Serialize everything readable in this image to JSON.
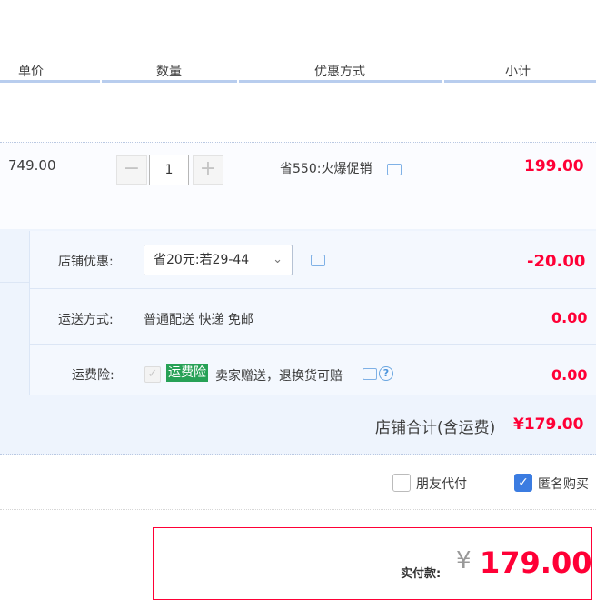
{
  "header": {
    "col_unit_price": "单价",
    "col_quantity": "数量",
    "col_promotion": "优惠方式",
    "col_subtotal": "小计"
  },
  "item": {
    "unit_price": "749.00",
    "quantity": "1",
    "stepper_minus": "−",
    "stepper_plus": "+",
    "promotion": "省550:火爆促销",
    "subtotal": "199.00"
  },
  "shop": {
    "discount_label": "店铺优惠:",
    "discount_selected": "省20元:若29-44",
    "discount_amount": "-20.00",
    "shipping_label": "运送方式:",
    "shipping_value": "普通配送 快递 免邮",
    "shipping_amount": "0.00",
    "insurance_label": "运费险:",
    "insurance_badge": "运费险",
    "insurance_text": "卖家赠送，退换货可赔",
    "insurance_amount": "0.00",
    "total_label": "店铺合计(含运费)",
    "total_amount": "¥179.00"
  },
  "options": {
    "friend_pay": "朋友代付",
    "anonymous": "匿名购买"
  },
  "payment": {
    "label": "实付款:",
    "currency": "¥",
    "amount": "179.00"
  },
  "colors": {
    "price_red": "#ff0036",
    "header_line": "#b8cdee",
    "badge_green": "#27a156"
  }
}
